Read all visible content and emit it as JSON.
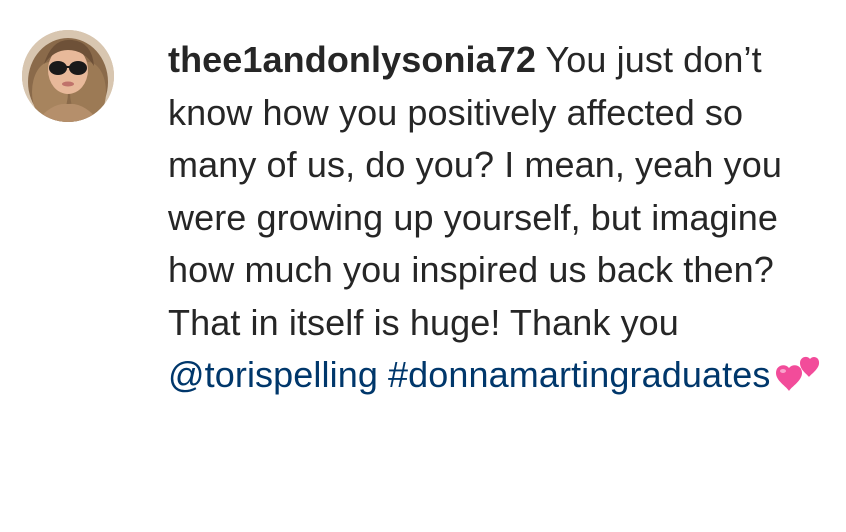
{
  "comment": {
    "username": "thee1andonlysonia72",
    "text": "You just don’t know how you positively affected so many of us, do you? I mean, yeah you were growing up yourself, but imagine how much you inspired us back then? That in itself is huge! Thank you",
    "mention": "@torispelling",
    "hashtag": "#donnamartingraduates",
    "emoji": "two-hearts-icon"
  },
  "colors": {
    "text": "#262626",
    "link": "#00376b",
    "background": "#ffffff",
    "heart": "#f24c9a"
  }
}
